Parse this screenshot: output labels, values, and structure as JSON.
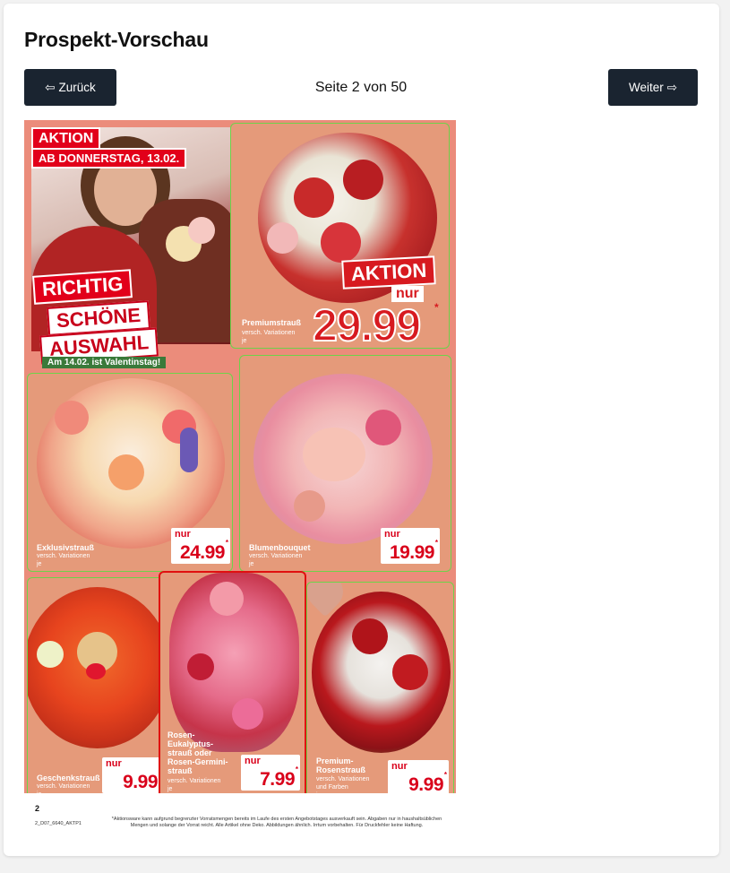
{
  "page": {
    "title": "Prospekt-Vorschau"
  },
  "navigation": {
    "prev_icon": "⇦",
    "prev_label": "Zurück",
    "next_label": "Weiter",
    "next_icon": "⇨",
    "page_indicator": "Seite 2 von 50"
  },
  "flyer": {
    "banner": {
      "aktion": "AKTION",
      "date": "AB DONNERSTAG, 13.02.",
      "slogan_1": "RICHTIG",
      "slogan_2": "SCHÖNE",
      "slogan_3": "AUSWAHL",
      "note": "Am 14.02. ist Valentinstag!"
    },
    "featured": {
      "name": "Premiumstrauß",
      "sub_1": "versch. Variationen",
      "sub_2": "je",
      "aktion": "AKTION",
      "nur": "nur",
      "price": "29.99",
      "star": "*"
    },
    "products": [
      {
        "name": "Exklusivstrauß",
        "sub_1": "versch. Variationen",
        "sub_2": "je",
        "nur": "nur",
        "price": "24.99",
        "star": "*"
      },
      {
        "name": "Blumenbouquet",
        "sub_1": "versch. Variationen",
        "sub_2": "je",
        "nur": "nur",
        "price": "19.99",
        "star": "*"
      },
      {
        "name": "Geschenkstrauß",
        "sub_1": "versch. Variationen",
        "sub_2": "je",
        "nur": "nur",
        "price": "9.99",
        "star": "*"
      },
      {
        "name_1": "Rosen-",
        "name_2": "Eukalyptus-",
        "name_3": "strauß oder",
        "name_4": "Rosen-Germini-",
        "name_5": "strauß",
        "sub_1": "versch. Variationen",
        "sub_2": "je",
        "nur": "nur",
        "price": "7.99",
        "star": "*"
      },
      {
        "name_1": "Premium-",
        "name_2": "Rosenstrauß",
        "sub_1": "versch. Variationen",
        "sub_2": "und Farben",
        "sub_3": "je",
        "nur": "nur",
        "price": "9.99",
        "star": "*"
      }
    ],
    "footer": {
      "page_number": "2",
      "code": "2_D07_6640_AKTP1",
      "note_1": "*Aktionsware kann aufgrund begrenzter Vorratsmengen bereits im Laufe des ersten Angebotstages ausverkauft sein. Abgaben nur in haushaltsüblichen",
      "note_2": "Mengen und solange der Vorrat reicht. Alle Artikel ohne Deko. Abbildungen ähnlich. Irrtum vorbehalten. Für Druckfehler keine Haftung."
    }
  },
  "colors": {
    "button_bg": "#1a2430",
    "flyer_bg": "#eb8c7b",
    "price_red": "#d9001a",
    "highlight_green": "#6ed24a",
    "highlight_red": "#e01010"
  }
}
